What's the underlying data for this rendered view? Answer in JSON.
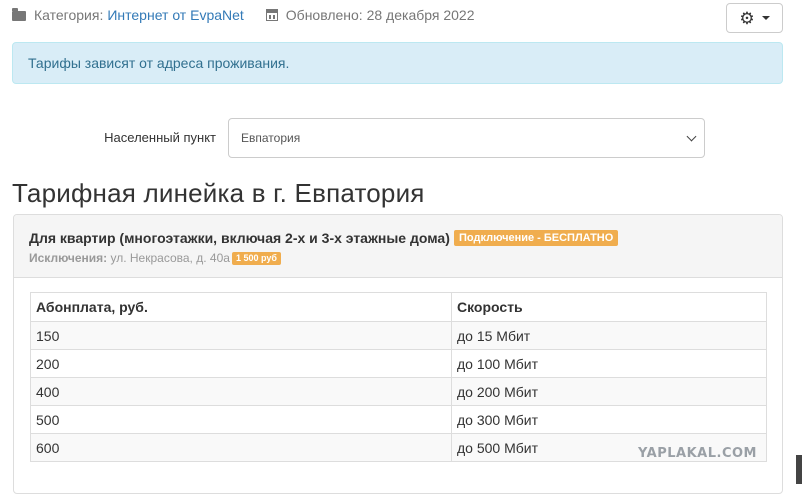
{
  "meta": {
    "category_label": "Категория:",
    "category_link": "Интернет от EvpaNet",
    "updated": "Обновлено: 28 декабря 2022"
  },
  "toolbar": {
    "icon": "gear-icon"
  },
  "alert": {
    "text": "Тарифы зависят от адреса проживания."
  },
  "location": {
    "label": "Населенный пункт",
    "selected": "Евпатория"
  },
  "heading": "Тарифная линейка в г. Евпатория",
  "panel": {
    "title": "Для квартир (многоэтажки, включая 2-х и 3-х этажные дома)",
    "badge_free": "Подключение - БЕСПЛАТНО",
    "exceptions_label": "Исключения:",
    "exceptions_value": "ул. Некрасова, д. 40а",
    "badge_price": "1 500 руб",
    "table": {
      "headers": [
        "Абонплата, руб.",
        "Скорость"
      ],
      "rows": [
        [
          "150",
          "до 15 Мбит"
        ],
        [
          "200",
          "до 100 Мбит"
        ],
        [
          "400",
          "до 200 Мбит"
        ],
        [
          "500",
          "до 300 Мбит"
        ],
        [
          "600",
          "до 500 Мбит"
        ]
      ]
    }
  },
  "watermark": "YAPLAKAL.COM",
  "colors": {
    "alert_bg": "#d9edf7",
    "alert_text": "#31708f",
    "badge": "#f0ad4e",
    "link": "#337ab7"
  }
}
